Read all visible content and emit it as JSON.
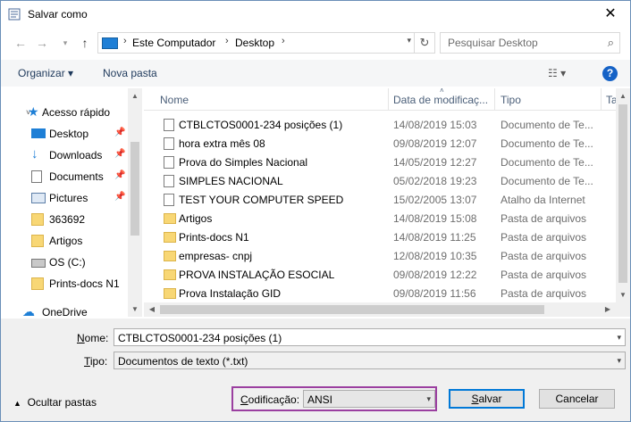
{
  "window": {
    "title": "Salvar como",
    "close_icon": "close-icon"
  },
  "address": {
    "crumbs": [
      "Este Computador",
      "Desktop"
    ]
  },
  "search": {
    "placeholder": "Pesquisar Desktop"
  },
  "toolbar": {
    "organize": "Organizar",
    "new_folder": "Nova pasta"
  },
  "sidebar": {
    "items": [
      {
        "label": "Acesso rápido"
      },
      {
        "label": "Desktop"
      },
      {
        "label": "Downloads"
      },
      {
        "label": "Documents"
      },
      {
        "label": "Pictures"
      },
      {
        "label": "363692"
      },
      {
        "label": "Artigos"
      },
      {
        "label": "OS (C:)"
      },
      {
        "label": "Prints-docs N1"
      },
      {
        "label": "OneDrive"
      }
    ]
  },
  "columns": {
    "name": "Nome",
    "date": "Data de modificaç...",
    "type": "Tipo",
    "size": "Ta"
  },
  "files": [
    {
      "name": "CTBLCTOS0001-234 posições (1)",
      "date": "14/08/2019 15:03",
      "type": "Documento de Te...",
      "icon": "doc"
    },
    {
      "name": "hora extra mês 08",
      "date": "09/08/2019 12:07",
      "type": "Documento de Te...",
      "icon": "doc"
    },
    {
      "name": "Prova do Simples Nacional",
      "date": "14/05/2019 12:27",
      "type": "Documento de Te...",
      "icon": "doc"
    },
    {
      "name": "SIMPLES NACIONAL",
      "date": "05/02/2018 19:23",
      "type": "Documento de Te...",
      "icon": "doc"
    },
    {
      "name": "TEST YOUR COMPUTER SPEED",
      "date": "15/02/2005 13:07",
      "type": "Atalho da Internet",
      "icon": "link"
    },
    {
      "name": "Artigos",
      "date": "14/08/2019 15:08",
      "type": "Pasta de arquivos",
      "icon": "folder"
    },
    {
      "name": "Prints-docs N1",
      "date": "14/08/2019 11:25",
      "type": "Pasta de arquivos",
      "icon": "folder"
    },
    {
      "name": "empresas- cnpj",
      "date": "12/08/2019 10:35",
      "type": "Pasta de arquivos",
      "icon": "folder"
    },
    {
      "name": "PROVA INSTALAÇÃO ESOCIAL",
      "date": "09/08/2019 12:22",
      "type": "Pasta de arquivos",
      "icon": "folder"
    },
    {
      "name": "Prova Instalação GID",
      "date": "09/08/2019 11:56",
      "type": "Pasta de arquivos",
      "icon": "folder"
    }
  ],
  "form": {
    "name_label_u": "N",
    "name_label_rest": "ome:",
    "name_value": "CTBLCTOS0001-234 posições (1)",
    "type_label_u": "T",
    "type_label_rest": "ipo:",
    "type_value": "Documentos de texto (*.txt)",
    "encoding_label_u": "C",
    "encoding_label_rest": "odificação:",
    "encoding_value": "ANSI",
    "hide_folders": "Ocultar pastas",
    "save_u": "S",
    "save_rest": "alvar",
    "cancel": "Cancelar"
  },
  "colors": {
    "accent": "#0078d7",
    "highlight_border": "#9b3fa0"
  }
}
